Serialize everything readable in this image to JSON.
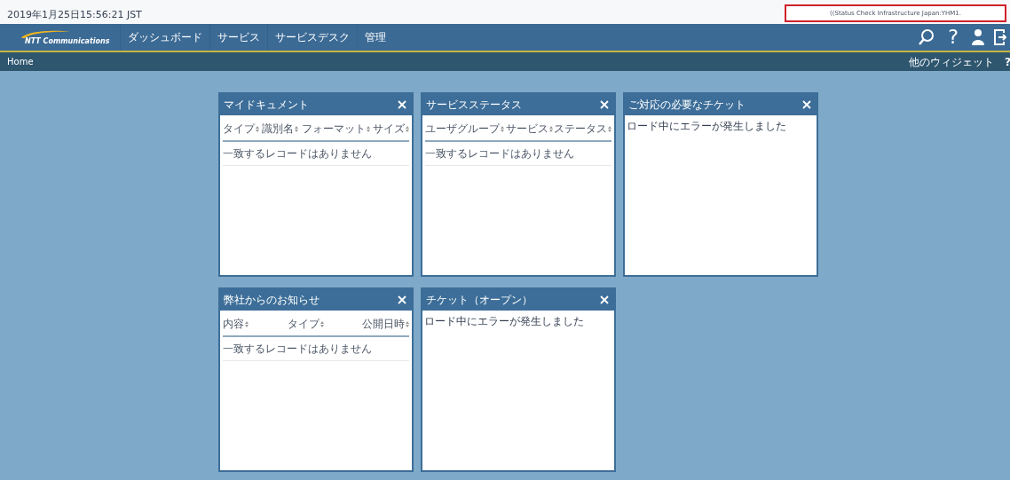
{
  "timestamp": "2019年1月25日15:56:21 JST",
  "status_message": "((Status Check Infrastructure Japan:YHM1.",
  "nav": {
    "logo": "NTT Communications",
    "items": [
      "ダッシュボード",
      "サービス",
      "サービスデスク",
      "管理"
    ]
  },
  "breadcrumb": "Home",
  "widgets_link": "他のウィジェット",
  "help_mark": "?",
  "widgets": [
    {
      "title": "マイドキュメント",
      "kind": "table",
      "columns": [
        "タイプ",
        "識別名",
        "フォーマット",
        "サイズ"
      ],
      "message": "一致するレコードはありません"
    },
    {
      "title": "サービスステータス",
      "kind": "table",
      "columns": [
        "ユーザグループ",
        "サービス",
        "ステータス"
      ],
      "message": "一致するレコードはありません"
    },
    {
      "title": "ご対応の必要なチケット",
      "kind": "error",
      "message": "ロード中にエラーが発生しました"
    },
    {
      "title": "弊社からのお知らせ",
      "kind": "table",
      "columns": [
        "内容",
        "タイプ",
        "公開日時"
      ],
      "message": "一致するレコードはありません"
    },
    {
      "title": "チケット（オープン）",
      "kind": "error",
      "message": "ロード中にエラーが発生しました"
    }
  ]
}
